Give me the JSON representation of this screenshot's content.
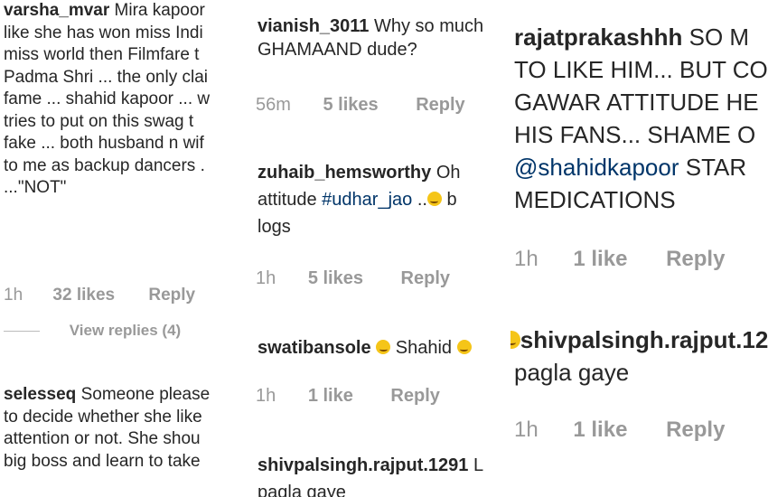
{
  "panel1": {
    "comment1": {
      "username": "varsha_mvar",
      "lines": [
        "Mira kapoor",
        "like she has won miss Indi",
        "miss world then Filmfare t",
        "Padma Shri ... the only clai",
        "fame ... shahid kapoor ... w",
        "tries to put on this swag t",
        "fake ... both husband n wif",
        "to me as backup dancers .",
        "...\"NOT\""
      ],
      "time": "1h",
      "likes": "32 likes",
      "reply": "Reply",
      "view_replies": "View replies (4)"
    },
    "comment2": {
      "username": "selesseq",
      "lines": [
        "Someone please",
        "to decide whether she like",
        "attention or not. She shou",
        "big boss and learn to take"
      ]
    }
  },
  "panel2": {
    "comment1": {
      "username": "vianish_3011",
      "lines": [
        "Why so much",
        "GHAMAAND dude?"
      ],
      "time": "56m",
      "likes": "5 likes",
      "reply": "Reply"
    },
    "comment2": {
      "username": "zuhaib_hemsworthy",
      "text_first": "Oh",
      "line2_pre": "attitude",
      "hashtag": "#udhar_jao",
      "line2_post": "..",
      "line2_tail": "b",
      "line3": "logs",
      "time": "1h",
      "likes": "5 likes",
      "reply": "Reply"
    },
    "comment3": {
      "username": "swatibansole",
      "text": "Shahid",
      "time": "1h",
      "likes": "1 like",
      "reply": "Reply"
    },
    "comment4": {
      "username": "shivpalsingh.rajput.1291",
      "text_first": "L",
      "line2": "pagla gaye"
    }
  },
  "panel3": {
    "comment1": {
      "username": "rajatprakashhh",
      "text_first": "SO M",
      "lines": [
        "TO LIKE HIM... BUT CO",
        "GAWAR ATTITUDE HE",
        "HIS FANS... SHAME O"
      ],
      "mention": "@shahidkapoor",
      "line5_post": "STAR",
      "line6": "MEDICATIONS",
      "time": "1h",
      "likes": "1 like",
      "reply": "Reply"
    },
    "comment2": {
      "username": "shivpalsingh.rajput.12",
      "line2": "pagla gaye",
      "time": "1h",
      "likes": "1 like",
      "reply": "Reply"
    }
  },
  "colors": {
    "text": "#262626",
    "meta": "#999999",
    "tag": "#003569",
    "emoji": "#f5c518"
  }
}
